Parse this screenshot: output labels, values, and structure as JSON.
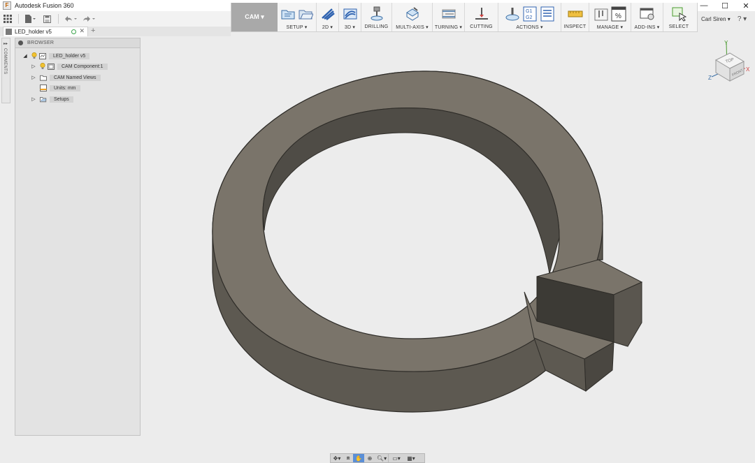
{
  "app": {
    "title": "Autodesk Fusion 360",
    "icon": "fusion-logo-icon"
  },
  "window_controls": [
    "minimize-icon",
    "maximize-icon",
    "close-icon"
  ],
  "quick_access": [
    "grid-menu-icon",
    "file-icon",
    "save-icon",
    "undo-icon",
    "redo-icon"
  ],
  "workspace": {
    "label": "CAM ▾"
  },
  "ribbon": {
    "groups": [
      {
        "label": "SETUP ▾",
        "icons": [
          "new-setup-icon",
          "setup-folder-icon"
        ]
      },
      {
        "label": "2D ▾",
        "icons": [
          "2d-toolpath-icon"
        ]
      },
      {
        "label": "3D ▾",
        "icons": [
          "3d-toolpath-icon"
        ]
      },
      {
        "label": "DRILLING",
        "icons": [
          "drill-icon"
        ]
      },
      {
        "label": "MULTI-AXIS ▾",
        "icons": [
          "multi-axis-icon"
        ]
      },
      {
        "label": "TURNING ▾",
        "icons": [
          "turning-icon"
        ]
      },
      {
        "label": "CUTTING",
        "icons": [
          "cutting-icon"
        ]
      },
      {
        "label": "ACTIONS ▾",
        "icons": [
          "simulate-icon",
          "post-process-icon",
          "setup-sheet-icon"
        ],
        "gcode": [
          "G1",
          "G2"
        ]
      },
      {
        "label": "INSPECT",
        "icons": [
          "measure-icon"
        ]
      },
      {
        "label": "MANAGE ▾",
        "icons": [
          "tool-library-icon",
          "template-icon"
        ]
      },
      {
        "label": "ADD-INS ▾",
        "icons": [
          "scripts-icon"
        ]
      },
      {
        "label": "SELECT",
        "icons": [
          "select-icon"
        ]
      }
    ]
  },
  "user": {
    "name": "Carl Siren ▾",
    "help": "? ▾"
  },
  "document": {
    "tab_title": "LED_holder v5",
    "close": "✕",
    "add": "+"
  },
  "comments": {
    "label": "COMMENTS",
    "collapse": "▸▸"
  },
  "browser": {
    "title": "BROWSER",
    "nodes": [
      {
        "label": "LED_holder v5",
        "expander": "◢",
        "has_bulb": true
      },
      {
        "label": "CAM Component:1",
        "expander": "▷",
        "has_bulb": true
      },
      {
        "label": "CAM Named Views",
        "expander": "▷",
        "has_bulb": false
      },
      {
        "label": "Units: mm",
        "expander": "",
        "has_bulb": false
      },
      {
        "label": "Setups",
        "expander": "▷",
        "has_bulb": false
      }
    ]
  },
  "viewcube": {
    "top": "TOP",
    "front": "FRONT",
    "axis_y": "Y",
    "axis_x": "X",
    "axis_z": "Z"
  },
  "nav_toolbar": [
    "orbit-icon",
    "look-at-icon",
    "pan-icon",
    "zoom-window-icon",
    "zoom-icon",
    "display-settings-icon",
    "grid-settings-icon"
  ],
  "colors": {
    "model_top": "#7a746a",
    "model_side": "#5a564f",
    "background": "#ececec",
    "accent": "#5b8fd6"
  }
}
